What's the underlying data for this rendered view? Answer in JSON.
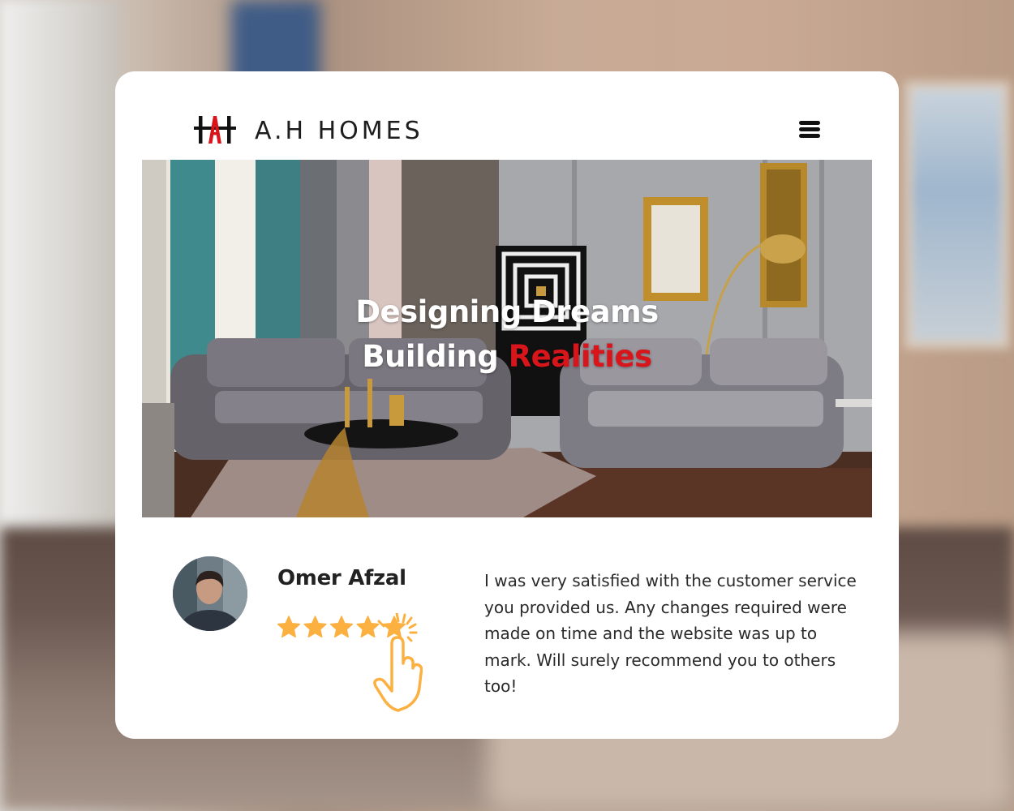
{
  "brand": {
    "name": "A.H HOMES",
    "accent_color": "#d8151b"
  },
  "nav": {
    "menu_icon": "hamburger-menu-icon"
  },
  "hero": {
    "line1": "Designing Dreams",
    "line2_prefix": "Building",
    "line2_accent": "Realities"
  },
  "testimonial": {
    "name": "Omer Afzal",
    "rating": 5,
    "rating_max": 5,
    "star_color": "#fbb040",
    "text": "I was very satisfied with the customer service you provided us. Any changes required were made on time and the website was up to mark. Will surely recommend you to others too!"
  }
}
